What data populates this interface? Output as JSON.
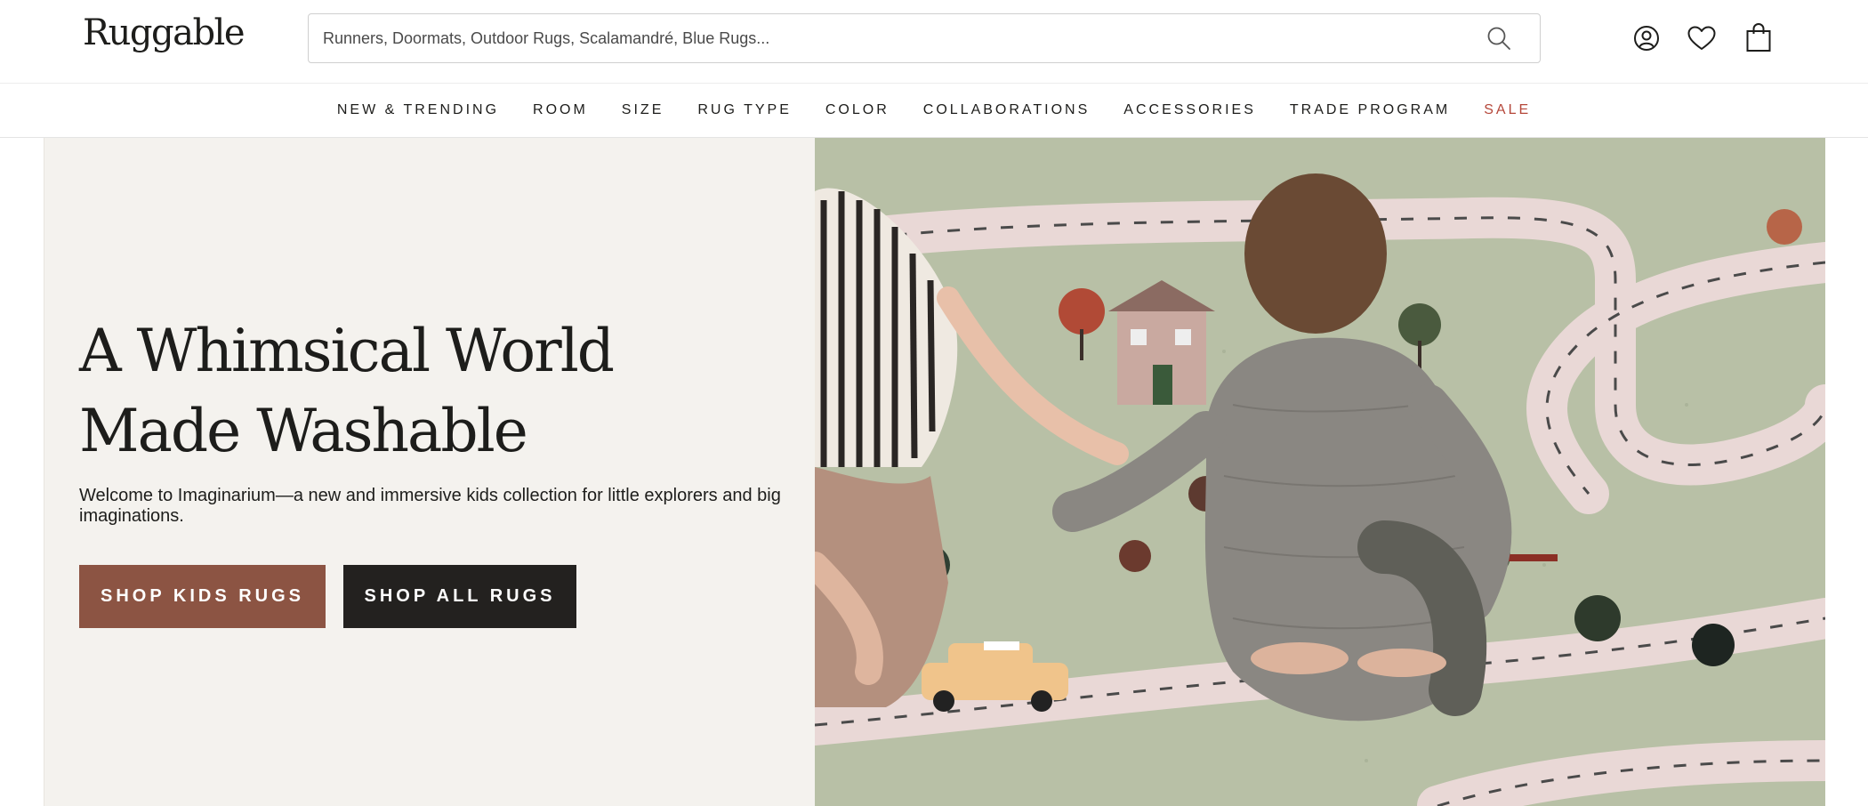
{
  "header": {
    "logo_text": "Ruggable",
    "search_placeholder": "Runners, Doormats, Outdoor Rugs, Scalamandré, Blue Rugs...",
    "icons": [
      "search-icon",
      "account-icon",
      "wishlist-heart-icon",
      "shopping-bag-icon"
    ]
  },
  "nav": {
    "items": [
      {
        "label": "NEW & TRENDING"
      },
      {
        "label": "ROOM"
      },
      {
        "label": "SIZE"
      },
      {
        "label": "RUG TYPE"
      },
      {
        "label": "COLOR"
      },
      {
        "label": "COLLABORATIONS"
      },
      {
        "label": "ACCESSORIES"
      },
      {
        "label": "TRADE PROGRAM"
      },
      {
        "label": "SALE"
      }
    ]
  },
  "hero": {
    "title_line1": "A Whimsical World",
    "title_line2": "Made Washable",
    "subtitle": "Welcome to Imaginarium—a new and immersive kids collection for little explorers and big imaginations.",
    "cta_primary": "SHOP KIDS RUGS",
    "cta_secondary": "SHOP ALL RUGS",
    "image_description_icon": "kids-playing-on-rug-photo"
  },
  "colors": {
    "brand_text": "#1d1d1b",
    "sale_red": "#b5473a",
    "cta_primary_bg": "#8c5443",
    "cta_secondary_bg": "#23211f",
    "hero_panel_bg": "#f4f2ee",
    "rug_green": "#b6bfa6"
  }
}
